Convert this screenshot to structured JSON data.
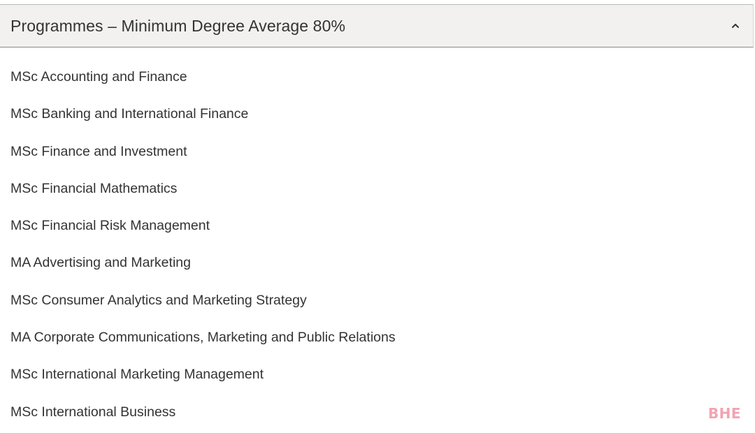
{
  "accordion": {
    "title": "Programmes – Minimum Degree Average 80%",
    "expanded": true,
    "toggle_icon": "chevron-up-icon"
  },
  "programmes": [
    "MSc Accounting and Finance",
    "MSc Banking and International Finance",
    "MSc Finance and Investment",
    "MSc Financial Mathematics",
    "MSc Financial Risk Management",
    "MA Advertising and Marketing",
    "MSc Consumer Analytics and Marketing Strategy",
    "MA Corporate Communications, Marketing and Public Relations",
    "MSc International Marketing Management",
    "MSc International Business"
  ],
  "watermark": "BHE",
  "colors": {
    "header_background": "#f2f1ef",
    "text": "#333333",
    "watermark": "#f2a3b3"
  }
}
